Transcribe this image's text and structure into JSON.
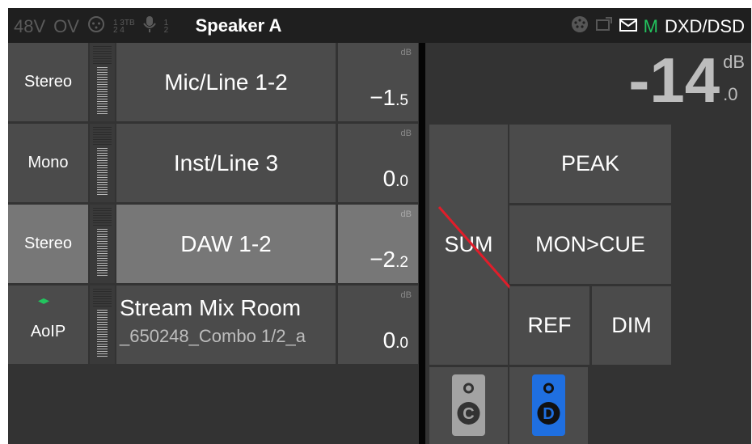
{
  "status_bar": {
    "phantom": "48V",
    "overvoltage": "OV",
    "input_group_top": "1 3TB",
    "input_group_bottom": "2 4",
    "mic_group_top": "1",
    "mic_group_bottom": "2",
    "title": "Speaker A",
    "m_indicator": "M",
    "format": "DXD/DSD",
    "icons": [
      "xlr-icon",
      "microphone-icon",
      "midi-icon",
      "screen-icon",
      "mail-icon"
    ]
  },
  "channels": [
    {
      "mode": "Stereo",
      "name": "Mic/Line 1-2",
      "db_unit": "dB",
      "gain_int": "−1",
      "gain_dec": ".5"
    },
    {
      "mode": "Mono",
      "name": "Inst/Line 3",
      "db_unit": "dB",
      "gain_int": "0",
      "gain_dec": ".0"
    },
    {
      "mode": "Stereo",
      "name": "DAW 1-2",
      "db_unit": "dB",
      "gain_int": "−2",
      "gain_dec": ".2",
      "selected": true
    },
    {
      "mode": "AoIP",
      "name": "Stream Mix Room",
      "subname": "_650248_Combo 1/2_a",
      "db_unit": "dB",
      "gain_int": "0",
      "gain_dec": ".0",
      "icon": "network-link-icon"
    }
  ],
  "level": {
    "value": "-14",
    "unit": "dB",
    "decimal": ".0"
  },
  "monitor": {
    "sum": "SUM",
    "peak": "PEAK",
    "mon_cue": "MON>CUE",
    "ref": "REF",
    "dim": "DIM",
    "speaker_c": "C",
    "speaker_d": "D"
  },
  "colors": {
    "accent_green": "#22c55e",
    "speaker_active": "#1f6fe0",
    "sum_strike": "#e11d2a",
    "selected_row": "#777777"
  }
}
